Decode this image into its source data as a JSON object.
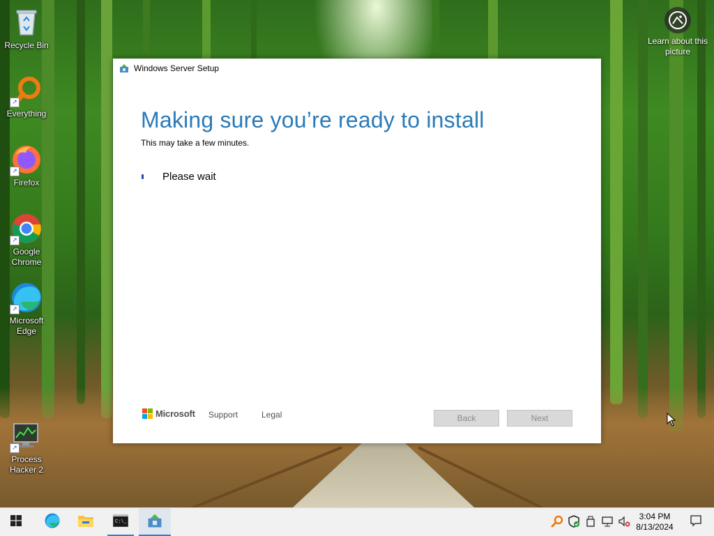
{
  "desktop": {
    "icons": [
      {
        "label": "Recycle Bin",
        "icon": "recycle-bin-icon"
      },
      {
        "label": "Everything",
        "icon": "everything-search-icon"
      },
      {
        "label": "Firefox",
        "icon": "firefox-icon"
      },
      {
        "label": "Google Chrome",
        "icon": "chrome-icon"
      },
      {
        "label": "Microsoft Edge",
        "icon": "edge-icon"
      },
      {
        "label": "Process Hacker 2",
        "icon": "process-hacker-icon"
      }
    ],
    "learn_about": "Learn about this picture"
  },
  "setup_window": {
    "title": "Windows Server Setup",
    "heading": "Making sure you’re ready to install",
    "subheading": "This may take a few minutes.",
    "status": "Please wait",
    "footer": {
      "brand": "Microsoft",
      "support": "Support",
      "legal": "Legal"
    },
    "buttons": {
      "back": "Back",
      "next": "Next"
    }
  },
  "taskbar": {
    "pinned": [
      {
        "name": "start-button",
        "icon": "windows-logo-icon"
      },
      {
        "name": "edge",
        "icon": "edge-icon"
      },
      {
        "name": "file-explorer",
        "icon": "folder-icon"
      },
      {
        "name": "command-prompt",
        "icon": "cmd-icon"
      },
      {
        "name": "windows-server-setup",
        "icon": "setup-icon"
      }
    ],
    "tray": [
      "everything-search-icon",
      "defender-shield-icon",
      "usb-device-icon",
      "network-icon",
      "volume-muted-icon"
    ],
    "clock": {
      "time": "3:04 PM",
      "date": "8/13/2024"
    }
  },
  "colors": {
    "heading_blue": "#2a7ab8",
    "taskbar_bg": "#f1f1f1",
    "accent": "#2d7dd2"
  }
}
